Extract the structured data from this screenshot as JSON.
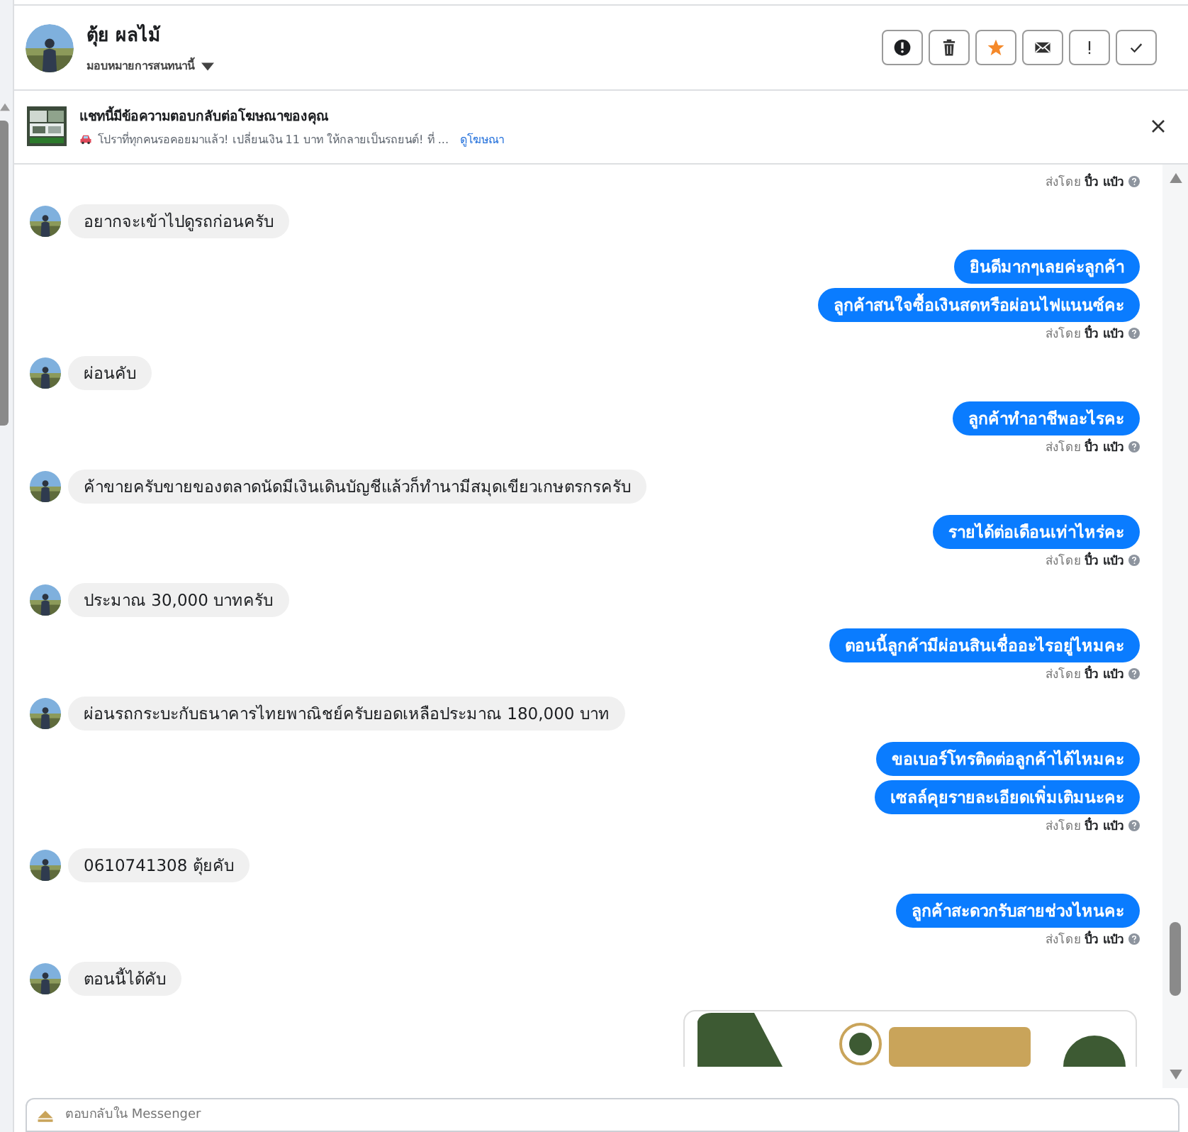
{
  "contact": {
    "name": "ตุ้ย ผลไม้",
    "assign_label": "มอบหมายการสนทนานี้"
  },
  "ad_reply": {
    "title": "แชทนี้มีข้อความตอบกลับต่อโฆษณาของคุณ",
    "snippet": "โปราที่ทุกคนรอคอยมาแล้ว! เปลี่ยนเงิน 11 บาท ให้กลายเป็นรถยนต์! ที่ ...",
    "link": "ดูโฆษณา"
  },
  "messages": [
    {
      "kind": "footer",
      "text": "ส่งโดย **ปิ๋ว แป๋ว**"
    },
    {
      "kind": "incoming",
      "text": "อยากจะเข้าไปดูรถก่อนครับ"
    },
    {
      "kind": "outgoing",
      "text": "ยินดีมากๆเลยค่ะลูกค้า"
    },
    {
      "kind": "outgoing",
      "text": "ลูกค้าสนใจซื้อเงินสดหรือผ่อนไฟแนนซ์คะ"
    },
    {
      "kind": "footer",
      "text": "ส่งโดย **ปิ๋ว แป๋ว**"
    },
    {
      "kind": "incoming",
      "text": "ผ่อนคับ"
    },
    {
      "kind": "outgoing",
      "text": "ลูกค้าทำอาชีพอะไรคะ"
    },
    {
      "kind": "footer",
      "text": "ส่งโดย **ปิ๋ว แป๋ว**"
    },
    {
      "kind": "incoming",
      "text": "ค้าขายครับขายของตลาดนัดมีเงินเดินบัญชีแล้วก็ทำนามีสมุดเขียวเกษตรกรครับ"
    },
    {
      "kind": "outgoing",
      "text": "รายได้ต่อเดือนเท่าไหร่คะ"
    },
    {
      "kind": "footer",
      "text": "ส่งโดย **ปิ๋ว แป๋ว**"
    },
    {
      "kind": "incoming",
      "text": "ประมาณ 30,000 บาทครับ"
    },
    {
      "kind": "outgoing",
      "text": "ตอนนี้ลูกค้ามีผ่อนสินเชื่ออะไรอยู่ไหมคะ"
    },
    {
      "kind": "footer",
      "text": "ส่งโดย **ปิ๋ว แป๋ว**"
    },
    {
      "kind": "incoming",
      "text": "ผ่อนรถกระบะกับธนาคารไทยพาณิชย์ครับยอดเหลือประมาณ 180,000 บาท"
    },
    {
      "kind": "outgoing",
      "text": "ขอเบอร์โทรติดต่อลูกค้าได้ไหมคะ"
    },
    {
      "kind": "outgoing",
      "text": "เซลล์คุยรายละเอียดเพิ่มเติมนะคะ"
    },
    {
      "kind": "footer",
      "text": "ส่งโดย **ปิ๋ว แป๋ว**"
    },
    {
      "kind": "incoming",
      "text": "0610741308 ตุ้ยคับ"
    },
    {
      "kind": "outgoing",
      "text": "ลูกค้าสะดวกรับสายช่วงไหนคะ"
    },
    {
      "kind": "footer",
      "text": "ส่งโดย **ปิ๋ว แป๋ว**"
    },
    {
      "kind": "incoming",
      "text": "ตอนนี้ได้คับ"
    },
    {
      "kind": "picture"
    }
  ],
  "composer": {
    "placeholder": "ตอบกลับใน Messenger"
  }
}
